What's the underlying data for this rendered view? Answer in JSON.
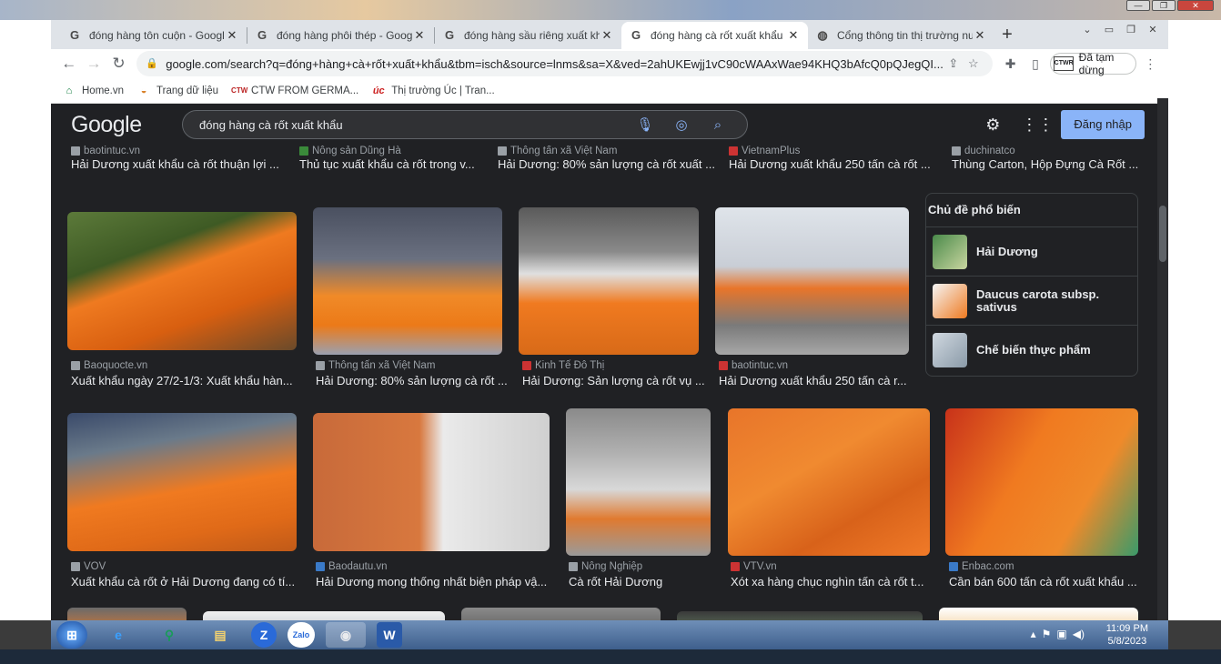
{
  "window_controls": [
    "—",
    "❐",
    "✕"
  ],
  "tabs": [
    {
      "title": "đóng hàng tôn cuộn - Google"
    },
    {
      "title": "đóng hàng phôi thép - Google"
    },
    {
      "title": "đóng hàng sầu riêng xuất khẩ"
    },
    {
      "title": "đóng hàng cà rốt xuất khẩu - "
    },
    {
      "title": "Cổng thông tin thị trường nươ"
    }
  ],
  "toolbar": {
    "url": "google.com/search?q=đóng+hàng+cà+rốt+xuất+khẩu&tbm=isch&source=lnms&sa=X&ved=2ahUKEwjj1vC90cWAAxWae94KHQ3bAfcQ0pQJegQI...",
    "profile_badge": "CTWR",
    "profile_status": "Đã tạm dừng"
  },
  "bookmarks": [
    {
      "label": "Home.vn"
    },
    {
      "label": "Trang dữ liệu"
    },
    {
      "label": "CTW FROM GERMA..."
    },
    {
      "label": "Thị trường Úc | Tran..."
    }
  ],
  "google": {
    "logo": "Google",
    "query": "đóng hàng cà rốt xuất khẩu",
    "signin": "Đăng nhập"
  },
  "row0": [
    {
      "source": "baotintuc.vn",
      "caption": "Hải Dương xuất khẩu cà rốt thuận lợi ..."
    },
    {
      "source": "Nông sản Dũng Hà",
      "caption": "Thủ tục xuất khẩu cà rốt trong v..."
    },
    {
      "source": "Thông tấn xã Việt Nam",
      "caption": "Hải Dương: 80% sản lượng cà rốt xuất ..."
    },
    {
      "source": "VietnamPlus",
      "caption": "Hải Dương xuất khẩu 250 tấn cà rốt ..."
    },
    {
      "source": "duchinatco",
      "caption": "Thùng Carton, Hộp Đựng Cà Rốt ..."
    }
  ],
  "row1": [
    {
      "source": "Baoquocte.vn",
      "caption": "Xuất khẩu ngày 27/2-1/3: Xuất khẩu hàn..."
    },
    {
      "source": "Thông tấn xã Việt Nam",
      "caption": "Hải Dương: 80% sản lượng cà rốt ..."
    },
    {
      "source": "Kinh Tế Đô Thị",
      "caption": "Hải Dương: Sản lượng cà rốt vụ ..."
    },
    {
      "source": "baotintuc.vn",
      "caption": "Hải Dương xuất khẩu 250 tấn cà r..."
    }
  ],
  "related": {
    "title": "Chủ đề phổ biến",
    "items": [
      {
        "label": "Hải Dương"
      },
      {
        "label": "Daucus carota subsp. sativus"
      },
      {
        "label": "Chế biến thực phẩm"
      }
    ]
  },
  "row2": [
    {
      "source": "VOV",
      "caption": "Xuất khẩu cà rốt ở Hải Dương đang có tí..."
    },
    {
      "source": "Baodautu.vn",
      "caption": "Hải Dương mong thống nhất biện pháp vậ..."
    },
    {
      "source": "Nông Nghiệp",
      "caption": "Cà rốt Hải Dương"
    },
    {
      "source": "VTV.vn",
      "caption": "Xót xa hàng chục nghìn tấn cà rốt t..."
    },
    {
      "source": "Enbac.com",
      "caption": "Cần bán 600 tấn cà rốt xuất khẩu ..."
    }
  ],
  "taskbar": {
    "items": [
      "e",
      "⚲",
      "▤",
      "Z",
      "Zalo",
      "◉",
      "W"
    ],
    "time": "11:09 PM",
    "date": "5/8/2023"
  }
}
